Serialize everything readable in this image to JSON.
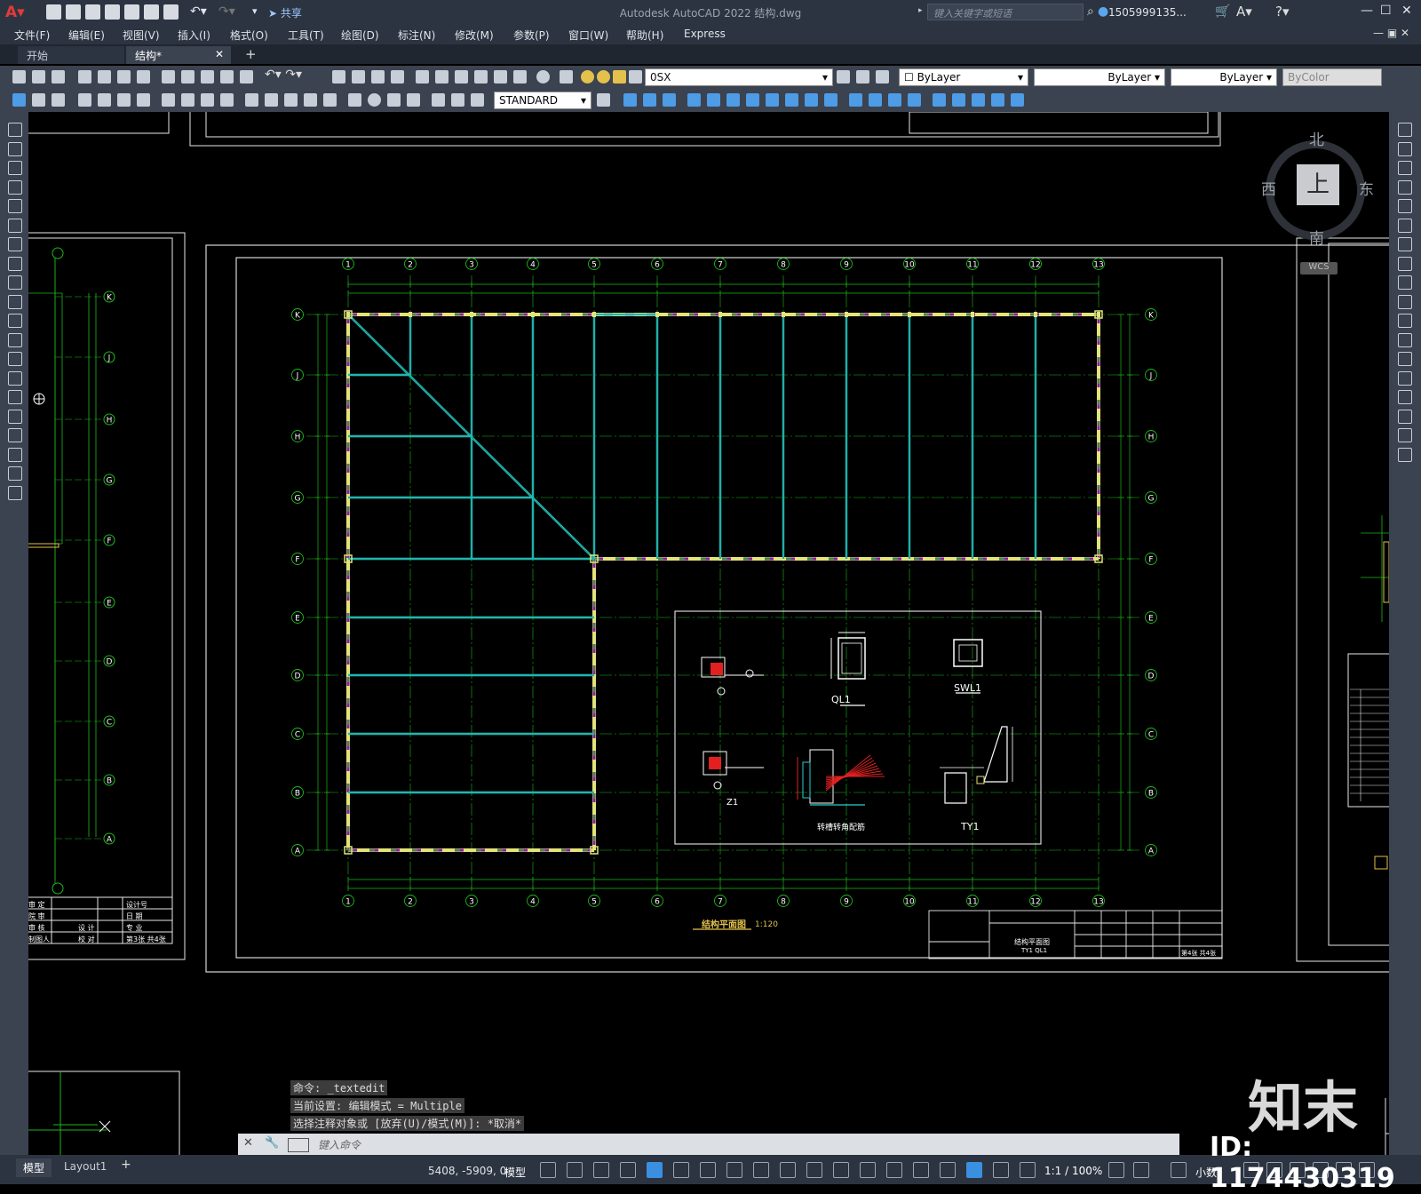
{
  "app": {
    "window_title": "Autodesk AutoCAD 2022    结构.dwg",
    "share_label": "共享",
    "search_placeholder": "键入关键字或短语",
    "user": "1505999135...",
    "menu": [
      "文件(F)",
      "编辑(E)",
      "视图(V)",
      "插入(I)",
      "格式(O)",
      "工具(T)",
      "绘图(D)",
      "标注(N)",
      "修改(M)",
      "参数(P)",
      "窗口(W)",
      "帮助(H)",
      "Express"
    ]
  },
  "tabs": [
    {
      "label": "开始",
      "active": false
    },
    {
      "label": "结构*",
      "active": true
    }
  ],
  "toolbar": {
    "layer_value": "0SX",
    "color_value": "ByLayer",
    "linetype_value": "ByLayer",
    "lineweight_value": "ByLayer",
    "plotstyle_value": "ByColor",
    "textstyle_value": "STANDARD"
  },
  "viewcube": {
    "north": "北",
    "south": "南",
    "east": "东",
    "west": "西",
    "top": "上",
    "wcs": "WCS"
  },
  "drawing": {
    "title": "结构平面图",
    "scale": "1:120",
    "col_axes": [
      "1",
      "2",
      "3",
      "4",
      "5",
      "6",
      "7",
      "8",
      "9",
      "10",
      "11",
      "12",
      "13"
    ],
    "row_axes": [
      "K",
      "J",
      "H",
      "G",
      "F",
      "E",
      "D",
      "C",
      "B",
      "A"
    ],
    "left_row_axes": [
      "K",
      "J",
      "H",
      "G",
      "F",
      "E",
      "D",
      "C",
      "B",
      "A"
    ],
    "details": [
      "QL1",
      "SWL1",
      "Z1",
      "转槽转角配筋",
      "TY1"
    ],
    "titleblock_left": [
      "审 定",
      "院 审",
      "审 核",
      "设 计",
      "校 对",
      "制图人"
    ],
    "titleblock_right": [
      "设计号",
      "日 期",
      "专 业",
      "第3张 共4张"
    ],
    "tb_main_labels": [
      "结构平面图",
      "TY1 QL1",
      "第4张 共4张"
    ]
  },
  "command": {
    "history": [
      "命令: _textedit",
      "当前设置: 编辑模式 = Multiple",
      "选择注释对象或 [放弃(U)/模式(M)]: *取消*"
    ],
    "prompt": "键入命令"
  },
  "status": {
    "layout_tabs": [
      "模型",
      "Layout1"
    ],
    "coords": "5408, -5909, 0",
    "model_label": "模型",
    "scale_label": "1:1 / 100%",
    "units_label": "小数"
  },
  "watermark": {
    "logo": "知末",
    "id": "ID: 1174430319"
  },
  "colors": {
    "beam": "#27d0c8",
    "axis": "#1db81d",
    "wall": "#8a1fa8",
    "background": "#000000",
    "ui": "#3b4250"
  }
}
